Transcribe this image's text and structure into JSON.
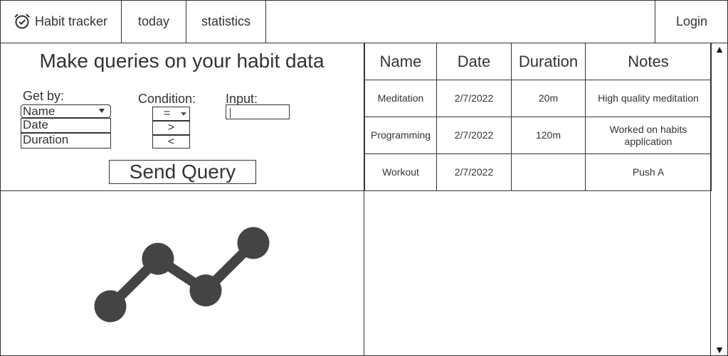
{
  "nav": {
    "brand": "Habit tracker",
    "brand_icon": "alarm-clock-icon",
    "today": "today",
    "statistics": "statistics",
    "login": "Login"
  },
  "query": {
    "title": "Make queries on your habit data",
    "get_by_label": "Get by:",
    "get_by_selected": "Name",
    "get_by_options": [
      "Date",
      "Duration"
    ],
    "condition_label": "Condition:",
    "condition_selected": "=",
    "condition_options": [
      ">",
      "<"
    ],
    "input_label": "Input:",
    "input_value": "",
    "send_label": "Send Query"
  },
  "table": {
    "headers": [
      "Name",
      "Date",
      "Duration",
      "Notes"
    ],
    "rows": [
      [
        "Meditation",
        "2/7/2022",
        "20m",
        "High quality meditation"
      ],
      [
        "Programming",
        "2/7/2022",
        "120m",
        "Worked on habits application"
      ],
      [
        "Workout",
        "2/7/2022",
        "",
        "Push A"
      ]
    ]
  },
  "chart_data": {
    "type": "line",
    "x": [
      1,
      2,
      3,
      4
    ],
    "values": [
      1,
      4,
      2,
      5
    ],
    "color": "#444444"
  },
  "scrollbar": {
    "up": "▲",
    "down": "▼"
  }
}
